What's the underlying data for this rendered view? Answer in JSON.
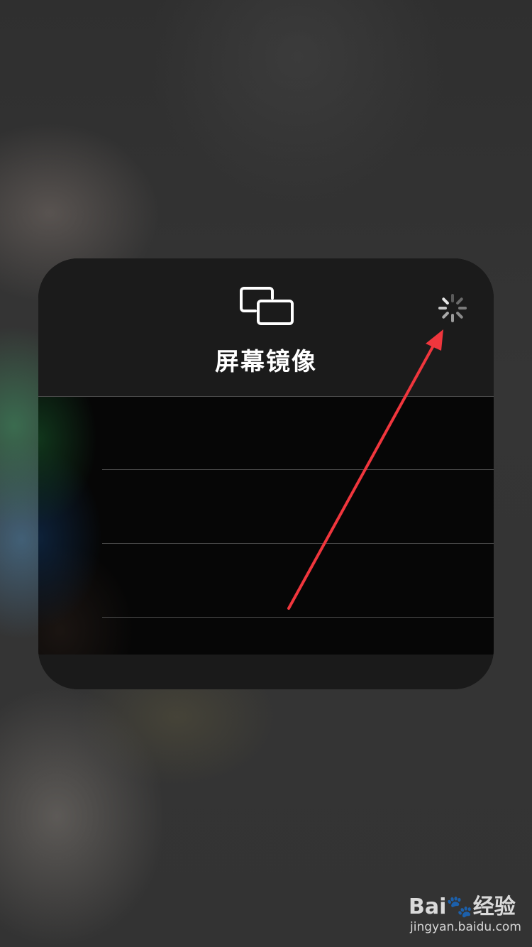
{
  "screen_mirroring": {
    "title": "屏幕镜像",
    "icon": "screen-mirroring-icon",
    "status_icon": "loading-spinner-icon"
  },
  "device_list": {
    "rows": [
      "",
      "",
      ""
    ]
  },
  "annotation": {
    "arrow_color": "#f0363d",
    "arrow_target": "loading-spinner-icon"
  },
  "watermark": {
    "logo": "Bai🐾经验",
    "url": "jingyan.baidu.com"
  },
  "colors": {
    "panel": "#141414",
    "panel_header": "#1b1b1b",
    "text": "#ffffff",
    "separator": "#4a4a4a"
  }
}
